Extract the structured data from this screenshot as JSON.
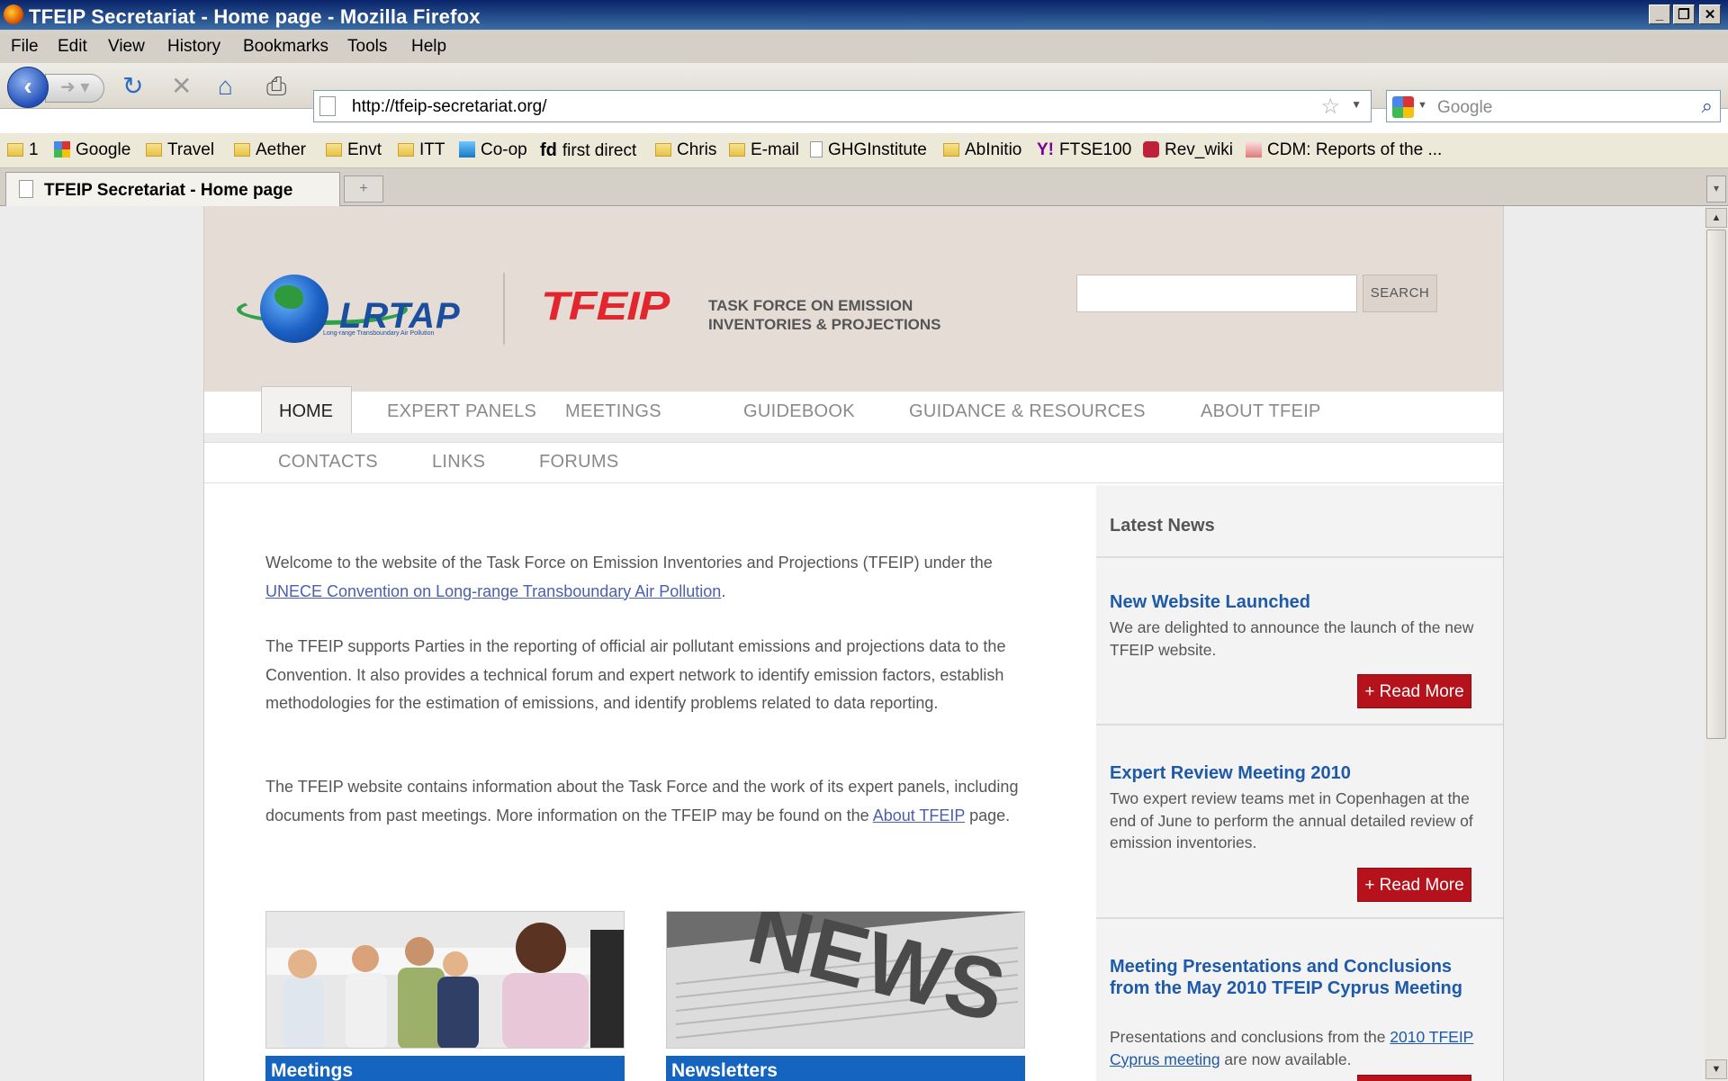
{
  "window": {
    "title": "TFEIP Secretariat - Home page - Mozilla Firefox"
  },
  "menu": [
    "File",
    "Edit",
    "View",
    "History",
    "Bookmarks",
    "Tools",
    "Help"
  ],
  "address": {
    "url": "http://tfeip-secretariat.org/"
  },
  "search_engine": {
    "placeholder": "Google"
  },
  "bookmarks": [
    "1",
    "Google",
    "Travel",
    "Aether",
    "Envt",
    "ITT",
    "Co-op",
    "first direct",
    "Chris",
    "E-mail",
    "GHGInstitute",
    "AbInitio",
    "FTSE100",
    "Rev_wiki",
    "CDM: Reports of the ..."
  ],
  "tab": {
    "title": "TFEIP Secretariat - Home page"
  },
  "site": {
    "lrtap": {
      "name": "LRTAP",
      "sub": "Long-range Transboundary Air Pollution"
    },
    "brand": "TFEIP",
    "tagline1": "TASK FORCE ON EMISSION",
    "tagline2": "INVENTORIES & PROJECTIONS",
    "search_label": "SEARCH"
  },
  "nav_primary": [
    "HOME",
    "EXPERT PANELS",
    "MEETINGS",
    "GUIDEBOOK",
    "GUIDANCE & RESOURCES",
    "ABOUT TFEIP"
  ],
  "nav_secondary": [
    "CONTACTS",
    "LINKS",
    "FORUMS"
  ],
  "content": {
    "p1_a": "Welcome to the website of the Task Force on Emission Inventories and Projections (TFEIP) under the ",
    "p1_link": "UNECE Convention on Long-range Transboundary Air Pollution",
    "p1_b": ".",
    "p2": "The TFEIP supports Parties in the reporting of official air pollutant emissions and projections data to the Convention.  It also provides a technical forum and expert network to identify emission factors, establish methodologies for the estimation of emissions, and identify problems related to data reporting.",
    "p3_a": "The TFEIP website contains information about the Task Force and the work of its expert panels, including documents from past meetings. More information on the TFEIP may be found on the ",
    "p3_link": "About TFEIP",
    "p3_b": " page.",
    "panels": [
      "Meetings",
      "Newsletters"
    ],
    "news_image_text": "NEWS"
  },
  "sidebar": {
    "heading": "Latest News",
    "read_more": "+ Read More",
    "items": [
      {
        "title": "New Website Launched",
        "body": "We are delighted to announce the launch of the new TFEIP website."
      },
      {
        "title": "Expert Review Meeting 2010",
        "body": "Two expert review teams met in Copenhagen at the end of June to perform the annual detailed review of emission inventories."
      },
      {
        "title": "Meeting Presentations and Conclusions from the May 2010 TFEIP Cyprus Meeting",
        "body_a": "Presentations and conclusions from the ",
        "body_link": "2010 TFEIP Cyprus meeting",
        "body_b": " are now available."
      }
    ]
  }
}
